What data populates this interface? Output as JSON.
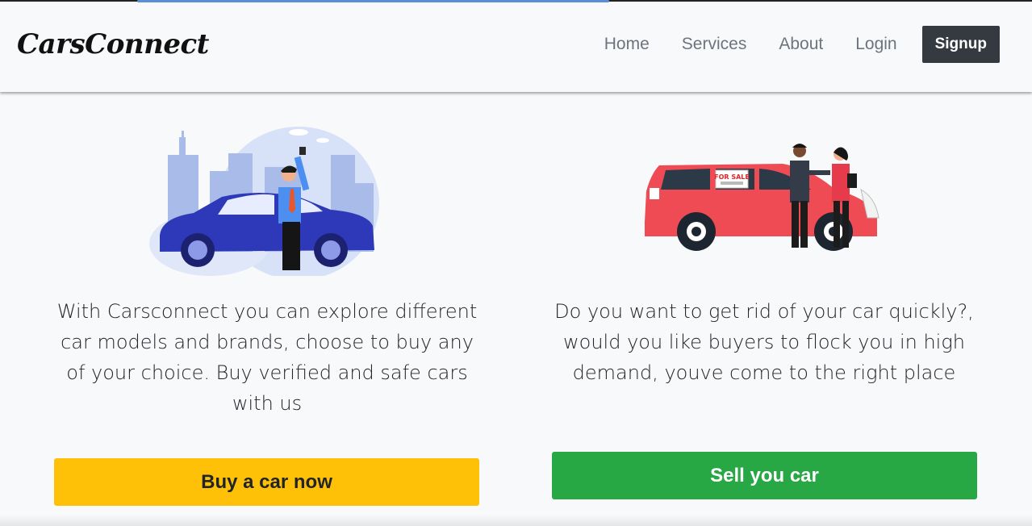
{
  "navbar": {
    "brand": "CarsConnect",
    "links": [
      {
        "label": "Home"
      },
      {
        "label": "Services"
      },
      {
        "label": "About"
      },
      {
        "label": "Login"
      }
    ],
    "signup_label": "Signup"
  },
  "buy_section": {
    "description": "With Carsconnect you can explore different car models and brands, choose to buy any of your choice. Buy verified and safe cars with us",
    "button_label": "Buy a car now",
    "accent": "#ffc107"
  },
  "sell_section": {
    "description": "Do you want to get rid of your car quickly?, would you like buyers to flock you in high demand, youve come to the right place",
    "button_label": "Sell you car",
    "sign_text": "FOR SALE",
    "accent": "#28a745"
  }
}
